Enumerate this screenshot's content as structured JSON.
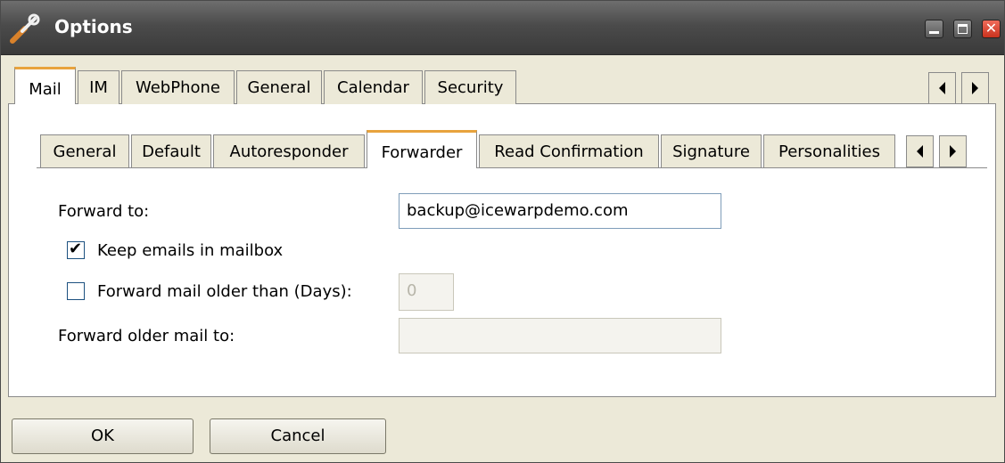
{
  "window": {
    "title": "Options",
    "icon": "wrench-icon",
    "accent_color": "#e8a33d",
    "close_color": "#d9412e"
  },
  "tabs": [
    {
      "label": "Mail",
      "active": true
    },
    {
      "label": "IM",
      "active": false
    },
    {
      "label": "WebPhone",
      "active": false
    },
    {
      "label": "General",
      "active": false
    },
    {
      "label": "Calendar",
      "active": false
    },
    {
      "label": "Security",
      "active": false
    }
  ],
  "mail_tabs": [
    {
      "label": "General",
      "active": false
    },
    {
      "label": "Default",
      "active": false
    },
    {
      "label": "Autoresponder",
      "active": false
    },
    {
      "label": "Forwarder",
      "active": true
    },
    {
      "label": "Read Confirmation",
      "active": false
    },
    {
      "label": "Signature",
      "active": false
    },
    {
      "label": "Personalities",
      "active": false
    }
  ],
  "form": {
    "forward_to_label": "Forward to:",
    "forward_to_value": "backup@icewarpdemo.com",
    "keep_emails_label": "Keep emails in mailbox",
    "keep_emails_checked": true,
    "forward_older_label": "Forward mail older than (Days):",
    "forward_older_checked": false,
    "days_value": "0",
    "forward_older_to_label": "Forward older mail to:",
    "forward_older_to_value": ""
  },
  "buttons": {
    "ok": "OK",
    "cancel": "Cancel"
  }
}
